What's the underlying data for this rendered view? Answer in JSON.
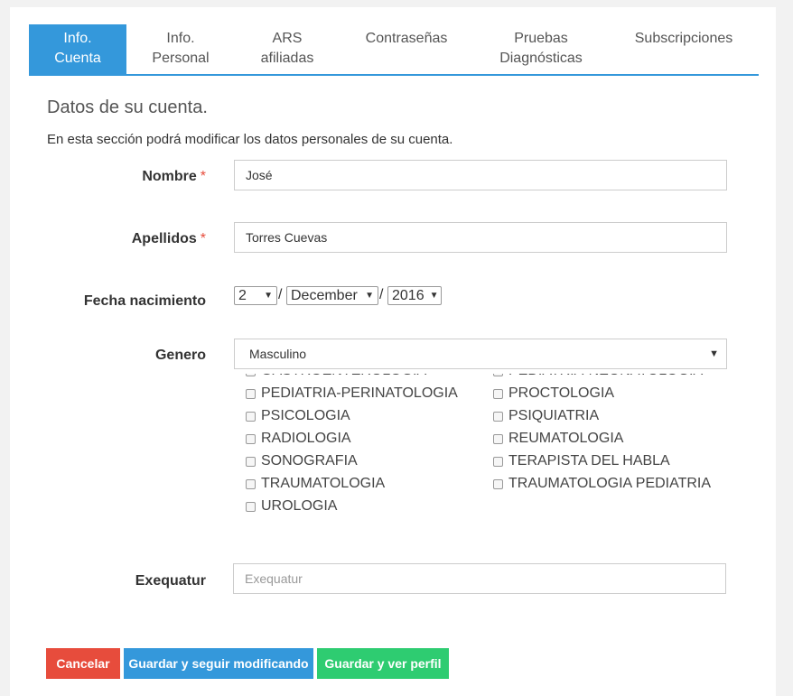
{
  "tabs": [
    {
      "line1": "Info.",
      "line2": "Cuenta"
    },
    {
      "line1": "Info.",
      "line2": "Personal"
    },
    {
      "line1": "ARS",
      "line2": "afiliadas"
    },
    {
      "line1": "Contraseñas",
      "line2": ""
    },
    {
      "line1": "Pruebas",
      "line2": "Diagnósticas"
    },
    {
      "line1": "Subscripciones",
      "line2": ""
    }
  ],
  "section": {
    "title": "Datos de su cuenta.",
    "description": "En esta sección podrá modificar los datos personales de su cuenta."
  },
  "form": {
    "nombre_label": "Nombre",
    "nombre_value": "José",
    "apellidos_label": "Apellidos",
    "apellidos_value": "Torres Cuevas",
    "required_mark": "*",
    "fecha_label": "Fecha nacimiento",
    "fecha_day": "2",
    "fecha_month": "December",
    "fecha_year": "2016",
    "date_separator": "/",
    "genero_label": "Genero",
    "genero_value": "Masculino",
    "exequatur_label": "Exequatur",
    "exequatur_placeholder": "Exequatur"
  },
  "specialties": {
    "left": [
      "GASTROENTEROLOGIA",
      "PEDIATRIA-PERINATOLOGIA",
      "PSICOLOGIA",
      "RADIOLOGIA",
      "SONOGRAFIA",
      "TRAUMATOLOGIA",
      "UROLOGIA"
    ],
    "right": [
      "PEDIATRIA-NEONATOLOGIA",
      "PROCTOLOGIA",
      "PSIQUIATRIA",
      "REUMATOLOGIA",
      "TERAPISTA DEL HABLA",
      "TRAUMATOLOGIA PEDIATRIA"
    ]
  },
  "buttons": {
    "cancel": "Cancelar",
    "save_continue": "Guardar y seguir modificando",
    "save_view": "Guardar y ver perfil"
  },
  "colors": {
    "primary": "#3498db",
    "danger": "#e74c3c",
    "success": "#2ecc71"
  },
  "icons": {
    "dropdown": "caret-down-icon",
    "checkbox": "checkbox-icon"
  }
}
